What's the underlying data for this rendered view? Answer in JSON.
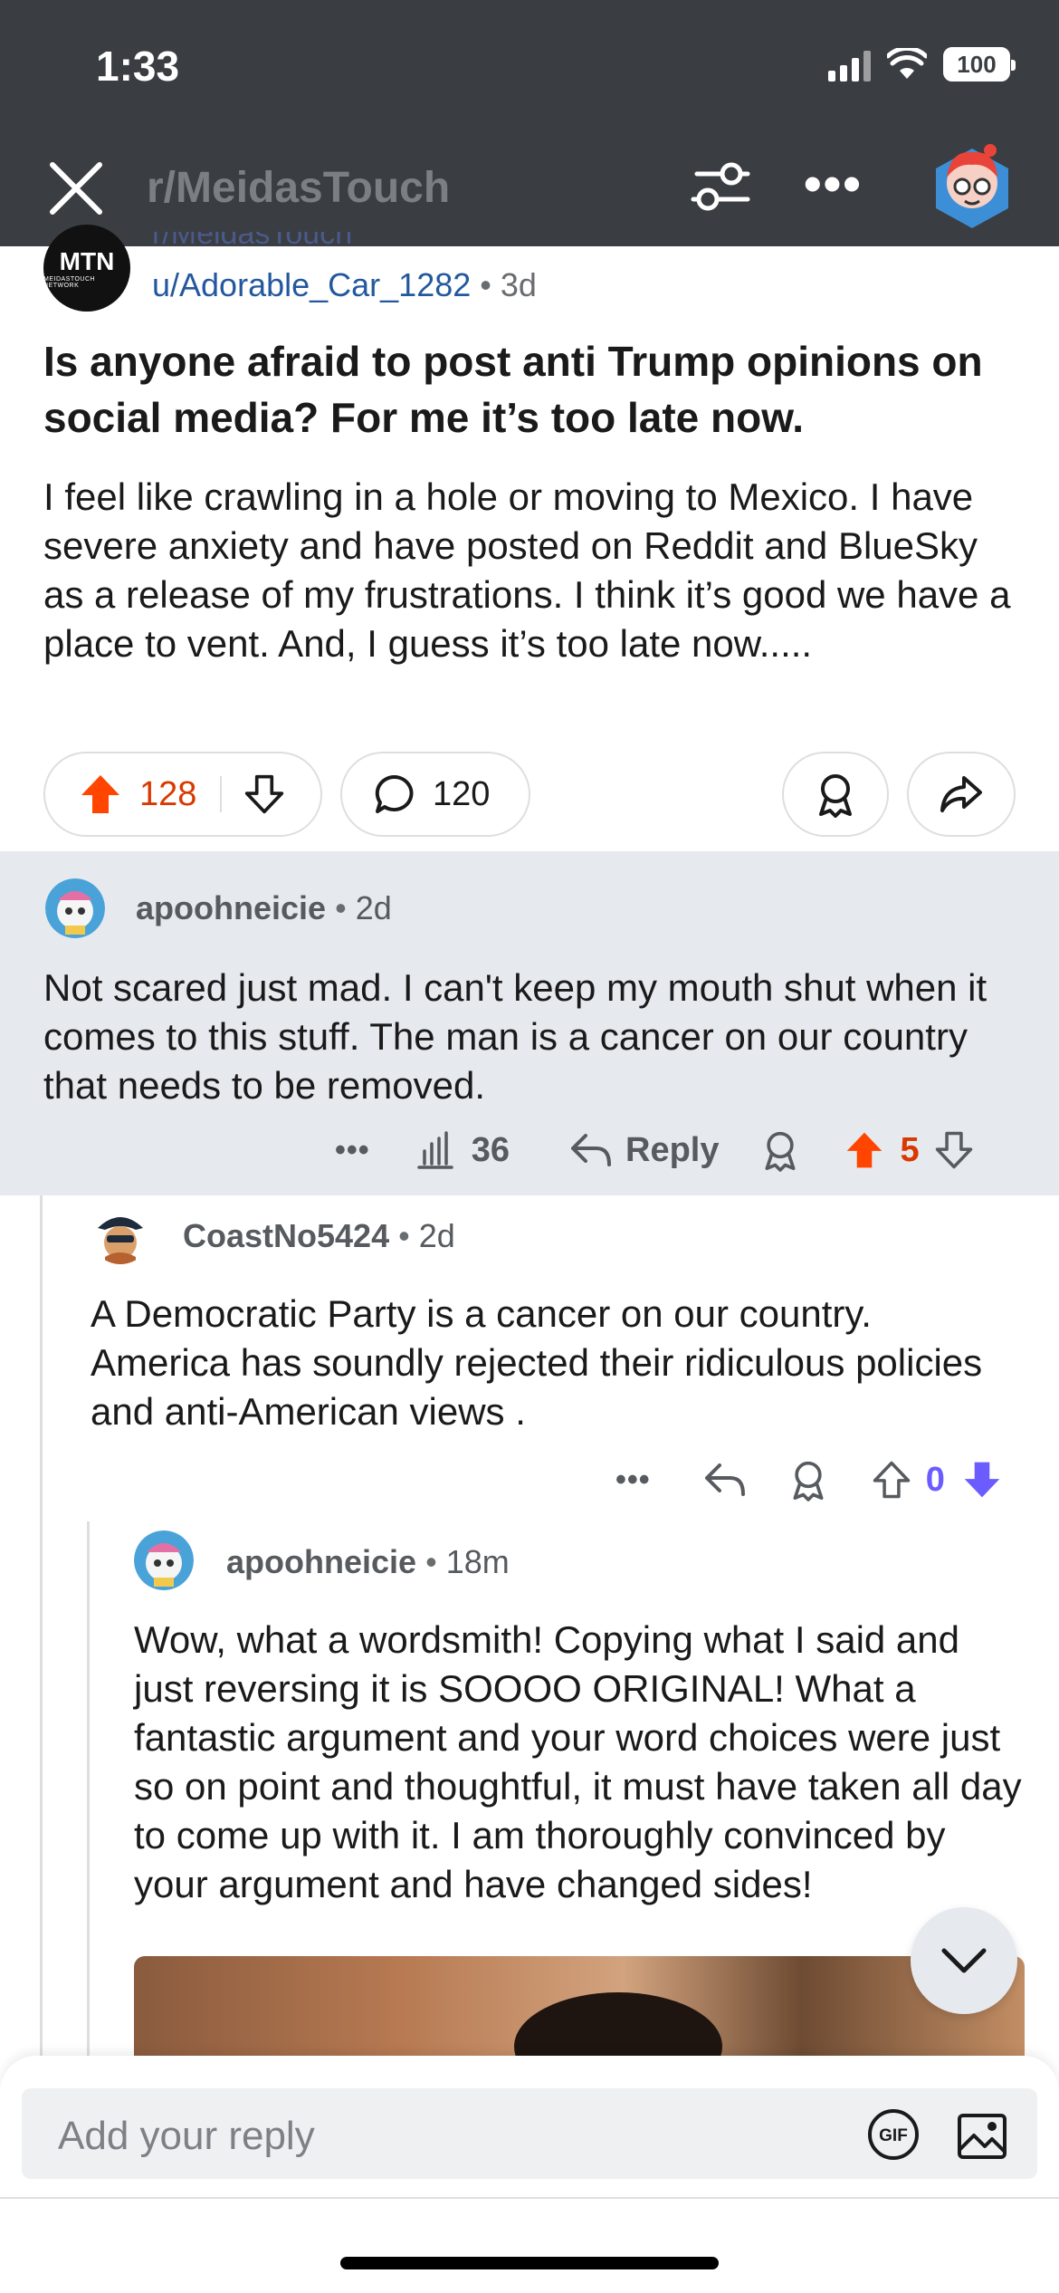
{
  "status": {
    "time": "1:33",
    "battery": "100"
  },
  "nav": {
    "title": "r/MeidasTouch",
    "more": "•••"
  },
  "post": {
    "subreddit_logo": "MTN",
    "subreddit_logo_small": "MEIDASTOUCH NETWORK",
    "subreddit": "r/MeidasTouch",
    "author": "u/Adorable_Car_1282",
    "separator": "•",
    "age": "3d",
    "title": "Is anyone afraid to post anti Trump opinions on social media? For me it’s too late now.",
    "body": "I feel like crawling in a hole or moving to Mexico. I have severe anxiety and have posted on  Reddit and BlueSky as a release of my frustrations. I think it’s good we have a place to vent. And, I guess it’s too late now.....",
    "upvotes": "128",
    "comments": "120"
  },
  "comments": [
    {
      "author": "apoohneicie",
      "separator": "•",
      "age": "2d",
      "text": "Not scared just mad. I can't keep my mouth shut when it comes to this stuff. The man is a cancer on our country that needs to be removed.",
      "more": "•••",
      "views": "36",
      "reply_label": "Reply",
      "score": "5"
    },
    {
      "author": "CoastNo5424",
      "separator": "•",
      "age": "2d",
      "text": "A Democratic Party is a cancer on our country. America has soundly rejected their ridiculous policies and anti-American views .",
      "more": "•••",
      "score": "0"
    },
    {
      "author": "apoohneicie",
      "separator": "•",
      "age": "18m",
      "text": "Wow, what a wordsmith! Copying what I said and just reversing it is SOOOO ORIGINAL! What a fantastic argument and your word choices were just so on point and thoughtful, it must have taken all day to come up with it. I am thoroughly convinced by your argument and have changed sides!"
    }
  ],
  "reply_bar": {
    "placeholder": "Add your reply",
    "gif_label": "GIF"
  },
  "colors": {
    "topbar": "#3a3d41",
    "upvote_active": "#ff4500",
    "upvote_count": "#d93900",
    "downvote_active": "#6a5cff",
    "author_link": "#24589e",
    "highlight_bg": "#e6eaee"
  },
  "icons": [
    "close-icon",
    "filter-icon",
    "more-icon",
    "avatar",
    "upvote-icon",
    "downvote-icon",
    "comment-icon",
    "award-icon",
    "share-icon",
    "views-icon",
    "reply-icon",
    "chevron-down-icon",
    "gif-icon",
    "image-icon"
  ]
}
